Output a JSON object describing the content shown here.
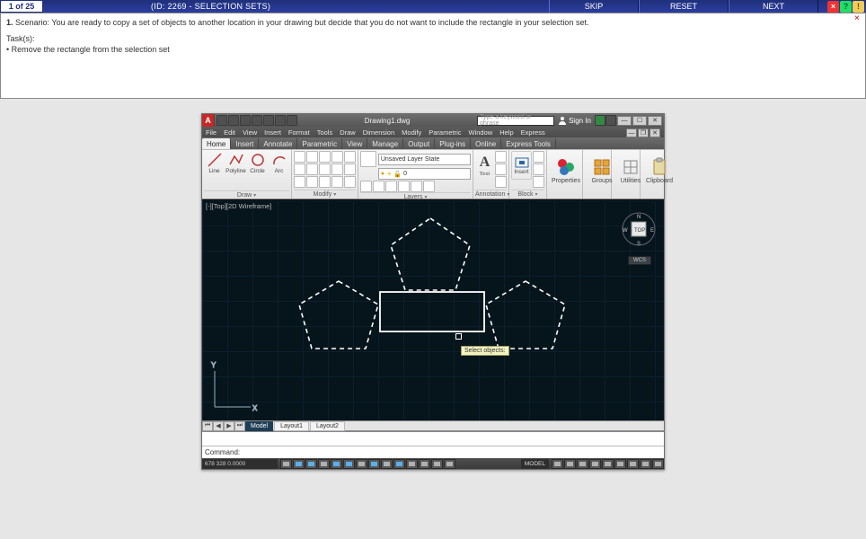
{
  "assess": {
    "counter": "1 of 25",
    "title": "(ID: 2269 - SELECTION SETS)",
    "skip": "SKIP",
    "reset": "RESET",
    "next": "NEXT",
    "num": "1.",
    "scenario_lbl": "Scenario:",
    "scenario": "You are ready to copy a set of objects to another location in your drawing but decide that you do not want to include the rectangle in your selection set.",
    "tasks_lbl": "Task(s):",
    "task1": "Remove the rectangle from the selection set"
  },
  "cad": {
    "docname": "Drawing1.dwg",
    "search_placeholder": "Type a keyword or phrase",
    "signin": "Sign In",
    "classic_menu": [
      "File",
      "Edit",
      "View",
      "Insert",
      "Format",
      "Tools",
      "Draw",
      "Dimension",
      "Modify",
      "Parametric",
      "Window",
      "Help",
      "Express"
    ],
    "ribbon_tabs": [
      "Home",
      "Insert",
      "Annotate",
      "Parametric",
      "View",
      "Manage",
      "Output",
      "Plug-ins",
      "Online",
      "Express Tools"
    ],
    "panels": {
      "draw": {
        "label": "Draw",
        "btns": [
          "Line",
          "Polyline",
          "Circle",
          "Arc"
        ]
      },
      "modify": {
        "label": "Modify"
      },
      "layers": {
        "label": "Layers",
        "combo": "Unsaved Layer State"
      },
      "annot": {
        "label": "Annotation",
        "text": "Text"
      },
      "block": {
        "label": "Block",
        "insert": "Insert"
      },
      "props": {
        "label": "Properties"
      },
      "groups": {
        "label": "Groups"
      },
      "utils": {
        "label": "Utilities"
      },
      "clip": {
        "label": "Clipboard"
      }
    },
    "view_label": "[-][Top][2D Wireframe]",
    "select_tip": "Select objects:",
    "wcs": "WCS",
    "layout_tabs": {
      "model": "Model",
      "l1": "Layout1",
      "l2": "Layout2"
    },
    "command_lbl": "Command:",
    "command_val": "",
    "coords": "678     328   0.0000",
    "model_label": "MODEL",
    "viewcube": {
      "n": "N",
      "s": "S",
      "e": "E",
      "w": "W",
      "top": "TOP"
    }
  }
}
